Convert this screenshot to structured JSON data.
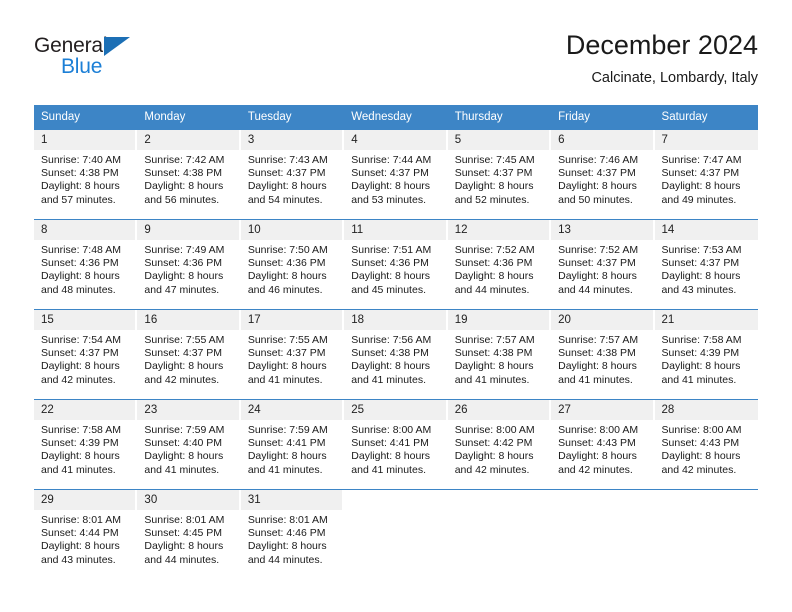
{
  "logo": {
    "word_top": "General",
    "word_bottom": "Blue",
    "triangle_color": "#1c6fb5",
    "blue_text_color": "#1c7fd6"
  },
  "header": {
    "title": "December 2024",
    "location": "Calcinate, Lombardy, Italy"
  },
  "theme": {
    "header_blue": "#3d85c6",
    "date_band_gray": "#f0f0f0",
    "text_color": "#1a1a1a"
  },
  "weekdays": [
    "Sunday",
    "Monday",
    "Tuesday",
    "Wednesday",
    "Thursday",
    "Friday",
    "Saturday"
  ],
  "weeks": [
    [
      {
        "day": "1",
        "sunrise": "Sunrise: 7:40 AM",
        "sunset": "Sunset: 4:38 PM",
        "daylight1": "Daylight: 8 hours",
        "daylight2": "and 57 minutes."
      },
      {
        "day": "2",
        "sunrise": "Sunrise: 7:42 AM",
        "sunset": "Sunset: 4:38 PM",
        "daylight1": "Daylight: 8 hours",
        "daylight2": "and 56 minutes."
      },
      {
        "day": "3",
        "sunrise": "Sunrise: 7:43 AM",
        "sunset": "Sunset: 4:37 PM",
        "daylight1": "Daylight: 8 hours",
        "daylight2": "and 54 minutes."
      },
      {
        "day": "4",
        "sunrise": "Sunrise: 7:44 AM",
        "sunset": "Sunset: 4:37 PM",
        "daylight1": "Daylight: 8 hours",
        "daylight2": "and 53 minutes."
      },
      {
        "day": "5",
        "sunrise": "Sunrise: 7:45 AM",
        "sunset": "Sunset: 4:37 PM",
        "daylight1": "Daylight: 8 hours",
        "daylight2": "and 52 minutes."
      },
      {
        "day": "6",
        "sunrise": "Sunrise: 7:46 AM",
        "sunset": "Sunset: 4:37 PM",
        "daylight1": "Daylight: 8 hours",
        "daylight2": "and 50 minutes."
      },
      {
        "day": "7",
        "sunrise": "Sunrise: 7:47 AM",
        "sunset": "Sunset: 4:37 PM",
        "daylight1": "Daylight: 8 hours",
        "daylight2": "and 49 minutes."
      }
    ],
    [
      {
        "day": "8",
        "sunrise": "Sunrise: 7:48 AM",
        "sunset": "Sunset: 4:36 PM",
        "daylight1": "Daylight: 8 hours",
        "daylight2": "and 48 minutes."
      },
      {
        "day": "9",
        "sunrise": "Sunrise: 7:49 AM",
        "sunset": "Sunset: 4:36 PM",
        "daylight1": "Daylight: 8 hours",
        "daylight2": "and 47 minutes."
      },
      {
        "day": "10",
        "sunrise": "Sunrise: 7:50 AM",
        "sunset": "Sunset: 4:36 PM",
        "daylight1": "Daylight: 8 hours",
        "daylight2": "and 46 minutes."
      },
      {
        "day": "11",
        "sunrise": "Sunrise: 7:51 AM",
        "sunset": "Sunset: 4:36 PM",
        "daylight1": "Daylight: 8 hours",
        "daylight2": "and 45 minutes."
      },
      {
        "day": "12",
        "sunrise": "Sunrise: 7:52 AM",
        "sunset": "Sunset: 4:36 PM",
        "daylight1": "Daylight: 8 hours",
        "daylight2": "and 44 minutes."
      },
      {
        "day": "13",
        "sunrise": "Sunrise: 7:52 AM",
        "sunset": "Sunset: 4:37 PM",
        "daylight1": "Daylight: 8 hours",
        "daylight2": "and 44 minutes."
      },
      {
        "day": "14",
        "sunrise": "Sunrise: 7:53 AM",
        "sunset": "Sunset: 4:37 PM",
        "daylight1": "Daylight: 8 hours",
        "daylight2": "and 43 minutes."
      }
    ],
    [
      {
        "day": "15",
        "sunrise": "Sunrise: 7:54 AM",
        "sunset": "Sunset: 4:37 PM",
        "daylight1": "Daylight: 8 hours",
        "daylight2": "and 42 minutes."
      },
      {
        "day": "16",
        "sunrise": "Sunrise: 7:55 AM",
        "sunset": "Sunset: 4:37 PM",
        "daylight1": "Daylight: 8 hours",
        "daylight2": "and 42 minutes."
      },
      {
        "day": "17",
        "sunrise": "Sunrise: 7:55 AM",
        "sunset": "Sunset: 4:37 PM",
        "daylight1": "Daylight: 8 hours",
        "daylight2": "and 41 minutes."
      },
      {
        "day": "18",
        "sunrise": "Sunrise: 7:56 AM",
        "sunset": "Sunset: 4:38 PM",
        "daylight1": "Daylight: 8 hours",
        "daylight2": "and 41 minutes."
      },
      {
        "day": "19",
        "sunrise": "Sunrise: 7:57 AM",
        "sunset": "Sunset: 4:38 PM",
        "daylight1": "Daylight: 8 hours",
        "daylight2": "and 41 minutes."
      },
      {
        "day": "20",
        "sunrise": "Sunrise: 7:57 AM",
        "sunset": "Sunset: 4:38 PM",
        "daylight1": "Daylight: 8 hours",
        "daylight2": "and 41 minutes."
      },
      {
        "day": "21",
        "sunrise": "Sunrise: 7:58 AM",
        "sunset": "Sunset: 4:39 PM",
        "daylight1": "Daylight: 8 hours",
        "daylight2": "and 41 minutes."
      }
    ],
    [
      {
        "day": "22",
        "sunrise": "Sunrise: 7:58 AM",
        "sunset": "Sunset: 4:39 PM",
        "daylight1": "Daylight: 8 hours",
        "daylight2": "and 41 minutes."
      },
      {
        "day": "23",
        "sunrise": "Sunrise: 7:59 AM",
        "sunset": "Sunset: 4:40 PM",
        "daylight1": "Daylight: 8 hours",
        "daylight2": "and 41 minutes."
      },
      {
        "day": "24",
        "sunrise": "Sunrise: 7:59 AM",
        "sunset": "Sunset: 4:41 PM",
        "daylight1": "Daylight: 8 hours",
        "daylight2": "and 41 minutes."
      },
      {
        "day": "25",
        "sunrise": "Sunrise: 8:00 AM",
        "sunset": "Sunset: 4:41 PM",
        "daylight1": "Daylight: 8 hours",
        "daylight2": "and 41 minutes."
      },
      {
        "day": "26",
        "sunrise": "Sunrise: 8:00 AM",
        "sunset": "Sunset: 4:42 PM",
        "daylight1": "Daylight: 8 hours",
        "daylight2": "and 42 minutes."
      },
      {
        "day": "27",
        "sunrise": "Sunrise: 8:00 AM",
        "sunset": "Sunset: 4:43 PM",
        "daylight1": "Daylight: 8 hours",
        "daylight2": "and 42 minutes."
      },
      {
        "day": "28",
        "sunrise": "Sunrise: 8:00 AM",
        "sunset": "Sunset: 4:43 PM",
        "daylight1": "Daylight: 8 hours",
        "daylight2": "and 42 minutes."
      }
    ],
    [
      {
        "day": "29",
        "sunrise": "Sunrise: 8:01 AM",
        "sunset": "Sunset: 4:44 PM",
        "daylight1": "Daylight: 8 hours",
        "daylight2": "and 43 minutes."
      },
      {
        "day": "30",
        "sunrise": "Sunrise: 8:01 AM",
        "sunset": "Sunset: 4:45 PM",
        "daylight1": "Daylight: 8 hours",
        "daylight2": "and 44 minutes."
      },
      {
        "day": "31",
        "sunrise": "Sunrise: 8:01 AM",
        "sunset": "Sunset: 4:46 PM",
        "daylight1": "Daylight: 8 hours",
        "daylight2": "and 44 minutes."
      },
      {
        "day": "",
        "sunrise": "",
        "sunset": "",
        "daylight1": "",
        "daylight2": ""
      },
      {
        "day": "",
        "sunrise": "",
        "sunset": "",
        "daylight1": "",
        "daylight2": ""
      },
      {
        "day": "",
        "sunrise": "",
        "sunset": "",
        "daylight1": "",
        "daylight2": ""
      },
      {
        "day": "",
        "sunrise": "",
        "sunset": "",
        "daylight1": "",
        "daylight2": ""
      }
    ]
  ]
}
